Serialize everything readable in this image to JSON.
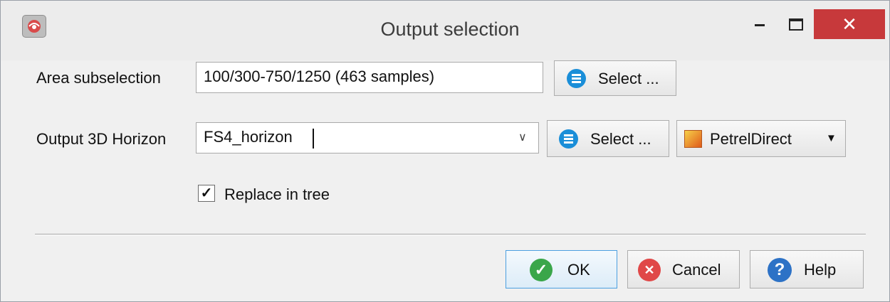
{
  "window": {
    "title": "Output selection",
    "close_glyph": "✕"
  },
  "area": {
    "label": "Area subselection",
    "value": "100/300-750/1250 (463 samples)",
    "select_label": "Select ..."
  },
  "horizon": {
    "label": "Output 3D Horizon",
    "value": "FS4_horizon",
    "select_label": "Select ...",
    "petrel_label": "PetrelDirect"
  },
  "replace": {
    "label": "Replace in tree",
    "checked": true
  },
  "buttons": {
    "ok": "OK",
    "cancel": "Cancel",
    "help": "Help"
  },
  "colors": {
    "accent_blue": "#1a8ed8",
    "close_red": "#c7393b",
    "ok_green": "#3aa64a",
    "cancel_red": "#e04848",
    "help_blue": "#2d72c6"
  }
}
